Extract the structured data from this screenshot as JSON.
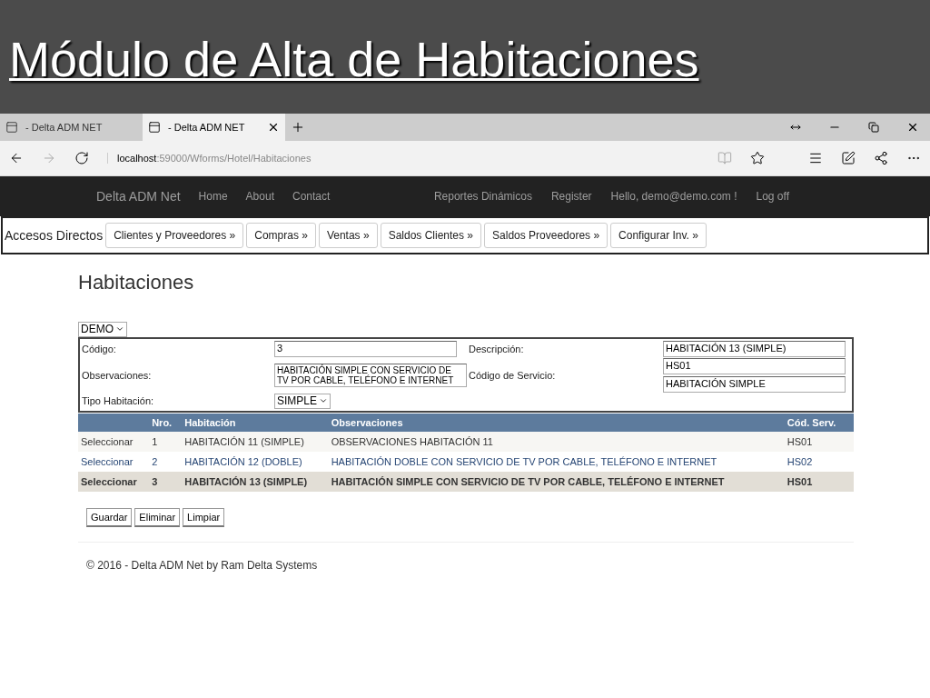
{
  "slide": {
    "title": "Módulo de Alta de Habitaciones"
  },
  "browser": {
    "tabs": [
      {
        "label": "- Delta ADM NET",
        "selected": false
      },
      {
        "label": "- Delta ADM NET",
        "selected": true
      }
    ],
    "address": {
      "host": "localhost",
      "path": ":59000/Wforms/Hotel/Habitaciones"
    }
  },
  "navbar": {
    "brand": "Delta ADM Net",
    "left_links": [
      "Home",
      "About",
      "Contact"
    ],
    "right_links": [
      "Reportes Dinámicos",
      "Register",
      "Hello, demo@demo.com !",
      "Log off"
    ]
  },
  "shortcuts": {
    "label": "Accesos Directos",
    "buttons": [
      "Clientes y Proveedores »",
      "Compras »",
      "Ventas »",
      "Saldos Clientes »",
      "Saldos Proveedores »",
      "Configurar Inv. »"
    ]
  },
  "page": {
    "heading": "Habitaciones",
    "company_select": "DEMO",
    "form": {
      "codigo_label": "Código:",
      "codigo": "3",
      "descripcion_label": "Descripción:",
      "descripcion": "HABITACIÓN 13 (SIMPLE)",
      "observaciones_label": "Observaciones:",
      "observaciones": "HABITACIÓN SIMPLE CON SERVICIO DE TV POR CABLE, TELÉFONO E INTERNET",
      "servicio_label": "Código de Servicio:",
      "servicio_codigo": "HS01",
      "servicio_nombre": "HABITACIÓN SIMPLE",
      "tipo_label": "Tipo Habitación:",
      "tipo": "SIMPLE"
    },
    "table": {
      "columns": [
        "Nro.",
        "Habitación",
        "Observaciones",
        "Cód. Serv."
      ],
      "rows": [
        {
          "action": "Seleccionar",
          "cells": [
            "1",
            "HABITACIÓN 11 (SIMPLE)",
            "OBSERVACIONES HABITACIÓN 11",
            "HS01"
          ],
          "selected": false
        },
        {
          "action": "Seleccionar",
          "cells": [
            "2",
            "HABITACIÓN 12 (DOBLE)",
            "HABITACIÓN DOBLE CON SERVICIO DE TV POR CABLE, TELÉFONO E INTERNET",
            "HS02"
          ],
          "selected": false
        },
        {
          "action": "Seleccionar",
          "cells": [
            "3",
            "HABITACIÓN 13 (SIMPLE)",
            "HABITACIÓN SIMPLE CON SERVICIO DE TV POR CABLE, TELÉFONO E INTERNET",
            "HS01"
          ],
          "selected": true
        }
      ]
    },
    "buttons": [
      "Guardar",
      "Eliminar",
      "Limpiar"
    ],
    "footer": "© 2016 - Delta ADM Net by Ram Delta Systems"
  }
}
